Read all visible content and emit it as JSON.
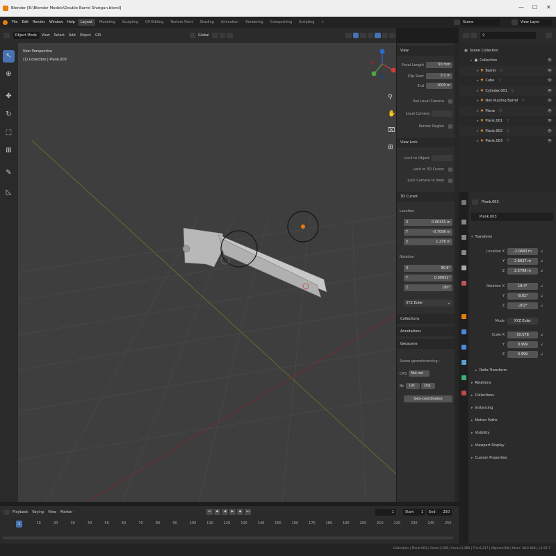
{
  "window": {
    "title": "Blender [E:\\Blender Models\\Double Barrel Shotgun.blend]",
    "minimize": "—",
    "maximize": "☐",
    "close": "✕"
  },
  "menu": [
    "File",
    "Edit",
    "Render",
    "Window",
    "Help"
  ],
  "workspaces": [
    "Layout",
    "Modeling",
    "Sculpting",
    "UV Editing",
    "Texture Paint",
    "Shading",
    "Animation",
    "Rendering",
    "Compositing",
    "Scripting"
  ],
  "workspace_add": "+",
  "scene": {
    "label": "Scene",
    "view_layer": "View Layer"
  },
  "viewport_header": {
    "mode": "Object Mode",
    "menus": [
      "View",
      "Select",
      "Add",
      "Object",
      "GIS"
    ],
    "orientation": "Global"
  },
  "viewport": {
    "perspective": "User Perspective",
    "collection": "(1) Collection | Plank.003"
  },
  "npanel": {
    "view_title": "View",
    "focal_length": {
      "label": "Focal Length",
      "value": "50 mm"
    },
    "clip_start": {
      "label": "Clip Start",
      "value": "0.1 m"
    },
    "clip_end": {
      "label": "End",
      "value": "1000 m"
    },
    "use_local_camera": "Use Local Camera",
    "local_camera": "Local Camera",
    "render_region": "Render Region",
    "view_lock": "View Lock",
    "lock_to_object": "Lock to Object",
    "lock_to_cursor": "Lock to 3D Cursor",
    "lock_camera": "Lock Camera to View",
    "cursor_title": "3D Cursor",
    "location_label": "Location",
    "location": [
      {
        "axis": "X",
        "value": "0.06331 m"
      },
      {
        "axis": "Y",
        "value": "-0.7096 m"
      },
      {
        "axis": "Z",
        "value": "1.278 m"
      }
    ],
    "rotation_label": "Rotation",
    "rotation": [
      {
        "axis": "X",
        "value": "90.8°"
      },
      {
        "axis": "Y",
        "value": "0.00052°"
      },
      {
        "axis": "Z",
        "value": "180°"
      }
    ],
    "rotation_mode": "XYZ Euler",
    "collections": "Collections",
    "annotations": "Annotations",
    "geoscene": "Geoscene",
    "scene_geo_tag": "Scene georeferencing :",
    "crs": {
      "label": "CRS",
      "value": "Not set"
    },
    "bk": {
      "label": "Bk",
      "lat": "Lat",
      "lng": "Lng"
    },
    "geo_button": "Geo-coordinates"
  },
  "outliner": {
    "title": "Scene Collection",
    "items": [
      {
        "name": "Collection",
        "indent": 1,
        "kind": "collection"
      },
      {
        "name": "Barrel",
        "indent": 2,
        "kind": "object"
      },
      {
        "name": "Cube",
        "indent": 2,
        "kind": "object"
      },
      {
        "name": "Cylinder.001",
        "indent": 2,
        "kind": "object"
      },
      {
        "name": "Non Rusting Barrel",
        "indent": 2,
        "kind": "object"
      },
      {
        "name": "Plane",
        "indent": 2,
        "kind": "object"
      },
      {
        "name": "Plank.001",
        "indent": 2,
        "kind": "object"
      },
      {
        "name": "Plank.002",
        "indent": 2,
        "kind": "object"
      },
      {
        "name": "Plank.003",
        "indent": 2,
        "kind": "object"
      }
    ]
  },
  "properties": {
    "object_name": "Plank.003",
    "header_name": "Plank.003",
    "transform": "Transform",
    "location_label": "Location X",
    "location": [
      {
        "axis": "X",
        "value": "-2.0843 m"
      },
      {
        "axis": "Y",
        "value": "2.8637 m"
      },
      {
        "axis": "Z",
        "value": "2.5798 m"
      }
    ],
    "rotation_label": "Rotation X",
    "rotation": [
      {
        "axis": "X",
        "value": "18.4°"
      },
      {
        "axis": "Y",
        "value": "-8.02°"
      },
      {
        "axis": "Z",
        "value": "-202°"
      }
    ],
    "mode": {
      "label": "Mode",
      "value": "XYZ Euler"
    },
    "scale_label": "Scale X",
    "scale": [
      {
        "axis": "X",
        "value": "10.578"
      },
      {
        "axis": "Y",
        "value": "0.999"
      },
      {
        "axis": "Z",
        "value": "0.999"
      }
    ],
    "sections": [
      "Delta Transform",
      "Relations",
      "Collections",
      "Instancing",
      "Motion Paths",
      "Visibility",
      "Viewport Display",
      "Custom Properties"
    ]
  },
  "timeline": {
    "menus": [
      "Playback",
      "Keying",
      "View",
      "Marker"
    ],
    "current_frame": "1",
    "start": {
      "label": "Start",
      "value": "1"
    },
    "end": {
      "label": "End",
      "value": "250"
    },
    "ticks": [
      "1",
      "10",
      "20",
      "30",
      "40",
      "50",
      "60",
      "70",
      "80",
      "90",
      "100",
      "110",
      "120",
      "130",
      "140",
      "150",
      "160",
      "170",
      "180",
      "190",
      "200",
      "210",
      "220",
      "230",
      "240",
      "250"
    ]
  },
  "statusbar": "Collection | Plank.003 | Verts:3,189 | Faces:3,160 | Tris:6,217 | Objects:0/8 | Mem: 38.6 MiB | v2.82.7",
  "colors": {
    "accent": "#4772b3",
    "orange": "#e87d0d",
    "x_axis": "#a03a3a",
    "y_axis": "#8a8a2a",
    "bg": "#3e3e3e"
  }
}
